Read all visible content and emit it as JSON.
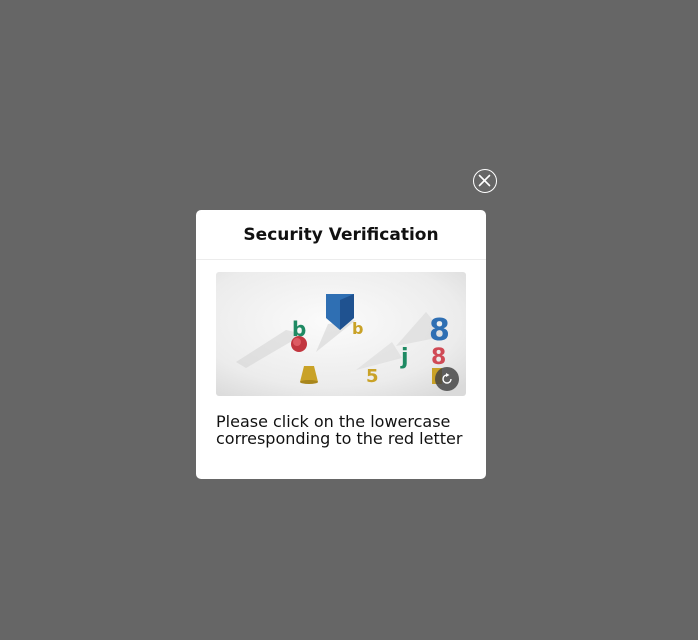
{
  "dialog": {
    "title": "Security Verification",
    "instruction": "Please click on the lowercase corresponding to the red letter"
  },
  "captcha": {
    "glyphs": [
      {
        "char": "b",
        "color": "#1f8a63"
      },
      {
        "char": "b",
        "color": "#c9a227"
      },
      {
        "char": "j",
        "color": "#1f8a63"
      },
      {
        "char": "8",
        "color": "#2f6fb3"
      },
      {
        "char": "8",
        "color": "#d04a55"
      },
      {
        "char": "5",
        "color": "#c9a227"
      }
    ]
  },
  "icons": {
    "close": "close-icon",
    "refresh": "refresh-icon"
  }
}
